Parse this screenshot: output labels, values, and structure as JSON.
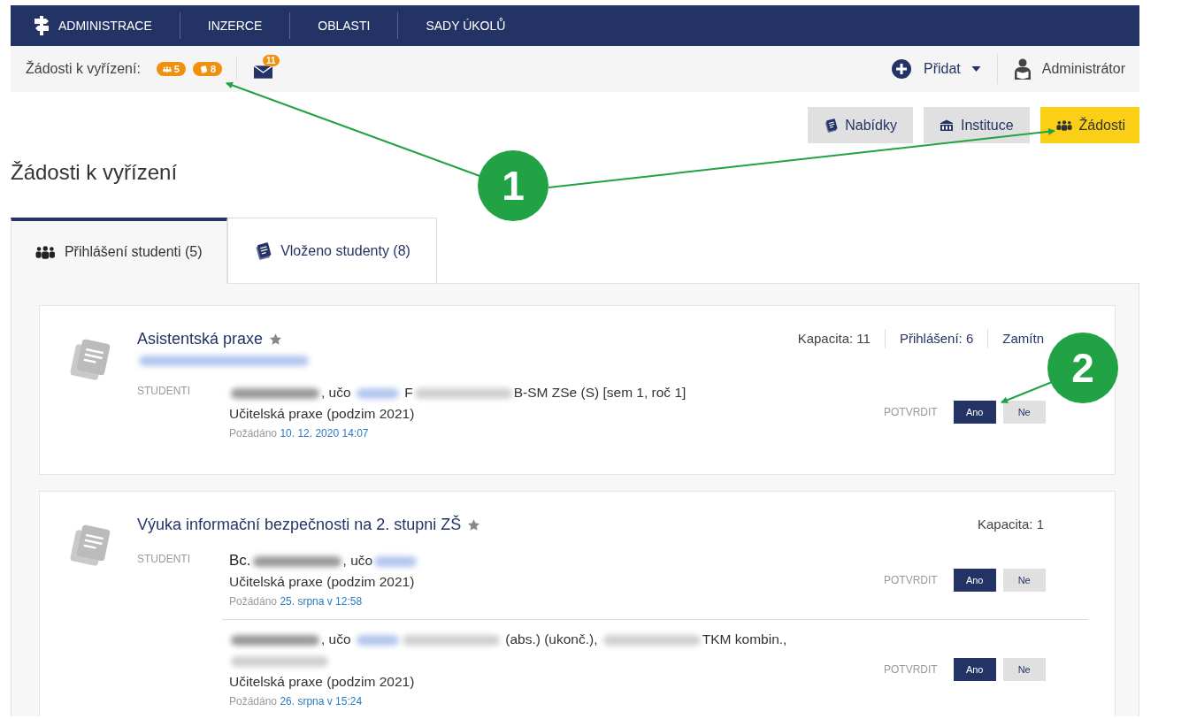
{
  "nav": {
    "items": [
      "ADMINISTRACE",
      "INZERCE",
      "OBLASTI",
      "SADY ÚKOLŮ"
    ]
  },
  "subbar": {
    "label": "Žádosti k vyřízení:",
    "badges": [
      {
        "kind": "people",
        "count": "5"
      },
      {
        "kind": "notes",
        "count": "8"
      }
    ],
    "mail_count": "11",
    "add": "Přidat",
    "user": "Administrátor"
  },
  "view_buttons": [
    {
      "label": "Nabídky",
      "selected": false
    },
    {
      "label": "Instituce",
      "selected": false
    },
    {
      "label": "Žádosti",
      "selected": true
    }
  ],
  "heading": "Žádosti k vyřízení",
  "tabs": [
    {
      "label": "Přihlášení studenti (5)",
      "selected": true
    },
    {
      "label": "Vloženo studenty (8)",
      "selected": false
    }
  ],
  "cards": [
    {
      "title": "Asistentská praxe",
      "starred": true,
      "subtitle": [
        {
          "kind": "hiddenschool"
        }
      ],
      "stats": [
        {
          "kind": "plain",
          "text": "Kapacita: 11"
        },
        {
          "kind": "link",
          "text": "Přihlášení: 6"
        },
        {
          "kind": "link",
          "text": "Zamítn"
        }
      ],
      "section_label": "STUDENTI",
      "students": [
        {
          "lines": [
            [
              {
                "kind": "hiddenname"
              },
              {
                "kind": "text",
                "text": ", učo "
              },
              {
                "kind": "hiddenid"
              },
              {
                "kind": "text",
                "text": " F"
              },
              {
                "kind": "hiddencode"
              },
              {
                "kind": "text",
                "text": "B-SM ZSe (S) [sem 1, roč 1]"
              }
            ]
          ],
          "program": "Učitelská praxe (podzim 2021)",
          "requested_label": "Požádáno",
          "requested_at": "10. 12. 2020 14:07",
          "confirm_label": "POTVRDIT",
          "yes": "Ano",
          "no": "Ne"
        }
      ]
    },
    {
      "title": "Výuka informační bezpečnosti na 2. stupni ZŠ",
      "starred": true,
      "stats": [
        {
          "kind": "plain",
          "text": "Kapacita: 1"
        }
      ],
      "section_label": "STUDENTI",
      "students": [
        {
          "lines": [
            [
              {
                "kind": "title",
                "text": "Bc."
              },
              {
                "kind": "hiddenname"
              },
              {
                "kind": "text",
                "text": ", učo"
              },
              {
                "kind": "hiddenid"
              }
            ]
          ],
          "program": "Učitelská praxe (podzim 2021)",
          "requested_label": "Požádáno",
          "requested_at": "25. srpna v 12:58",
          "confirm_label": "POTVRDIT",
          "yes": "Ano",
          "no": "Ne"
        },
        {
          "lines": [
            [
              {
                "kind": "hiddenname"
              },
              {
                "kind": "text",
                "text": ", učo "
              },
              {
                "kind": "hiddenid"
              },
              {
                "kind": "hiddencode"
              },
              {
                "kind": "text",
                "text": " (abs.) (ukonč.), "
              },
              {
                "kind": "hiddencode"
              },
              {
                "kind": "text",
                "text": "TKM kombin.,"
              }
            ],
            [
              {
                "kind": "hiddencode"
              }
            ]
          ],
          "program": "Učitelská praxe (podzim 2021)",
          "requested_label": "Požádáno",
          "requested_at": "26. srpna v 15:24",
          "confirm_label": "POTVRDIT",
          "yes": "Ano",
          "no": "Ne"
        }
      ]
    }
  ],
  "annotations": [
    {
      "label": "1"
    },
    {
      "label": "2"
    }
  ]
}
